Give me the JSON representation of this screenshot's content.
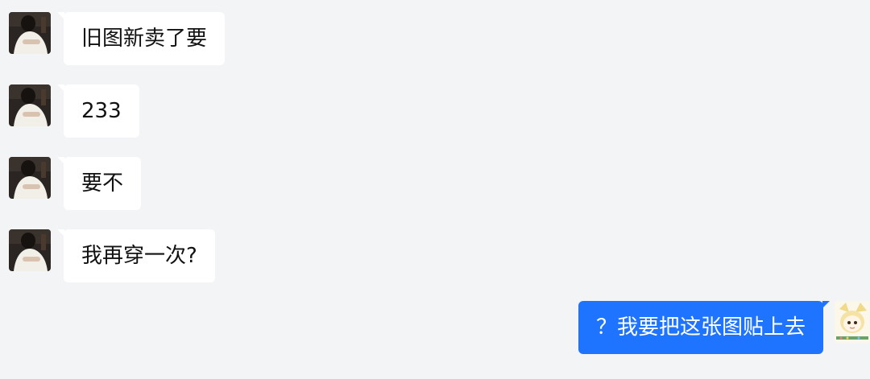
{
  "theme": {
    "background": "#f3f4f6",
    "incoming_bubble": "#ffffff",
    "outgoing_bubble": "#1f74ff"
  },
  "messages": [
    {
      "sender": "contact",
      "text": "旧图新卖了要",
      "avatar_icon": "contact-avatar-icon"
    },
    {
      "sender": "contact",
      "text": "233",
      "avatar_icon": "contact-avatar-icon"
    },
    {
      "sender": "contact",
      "text": "要不",
      "avatar_icon": "contact-avatar-icon"
    },
    {
      "sender": "contact",
      "text": "我再穿一次?",
      "avatar_icon": "contact-avatar-icon"
    },
    {
      "sender": "self",
      "text": "？我要把这张图贴上去",
      "avatar_icon": "self-avatar-icon"
    }
  ]
}
